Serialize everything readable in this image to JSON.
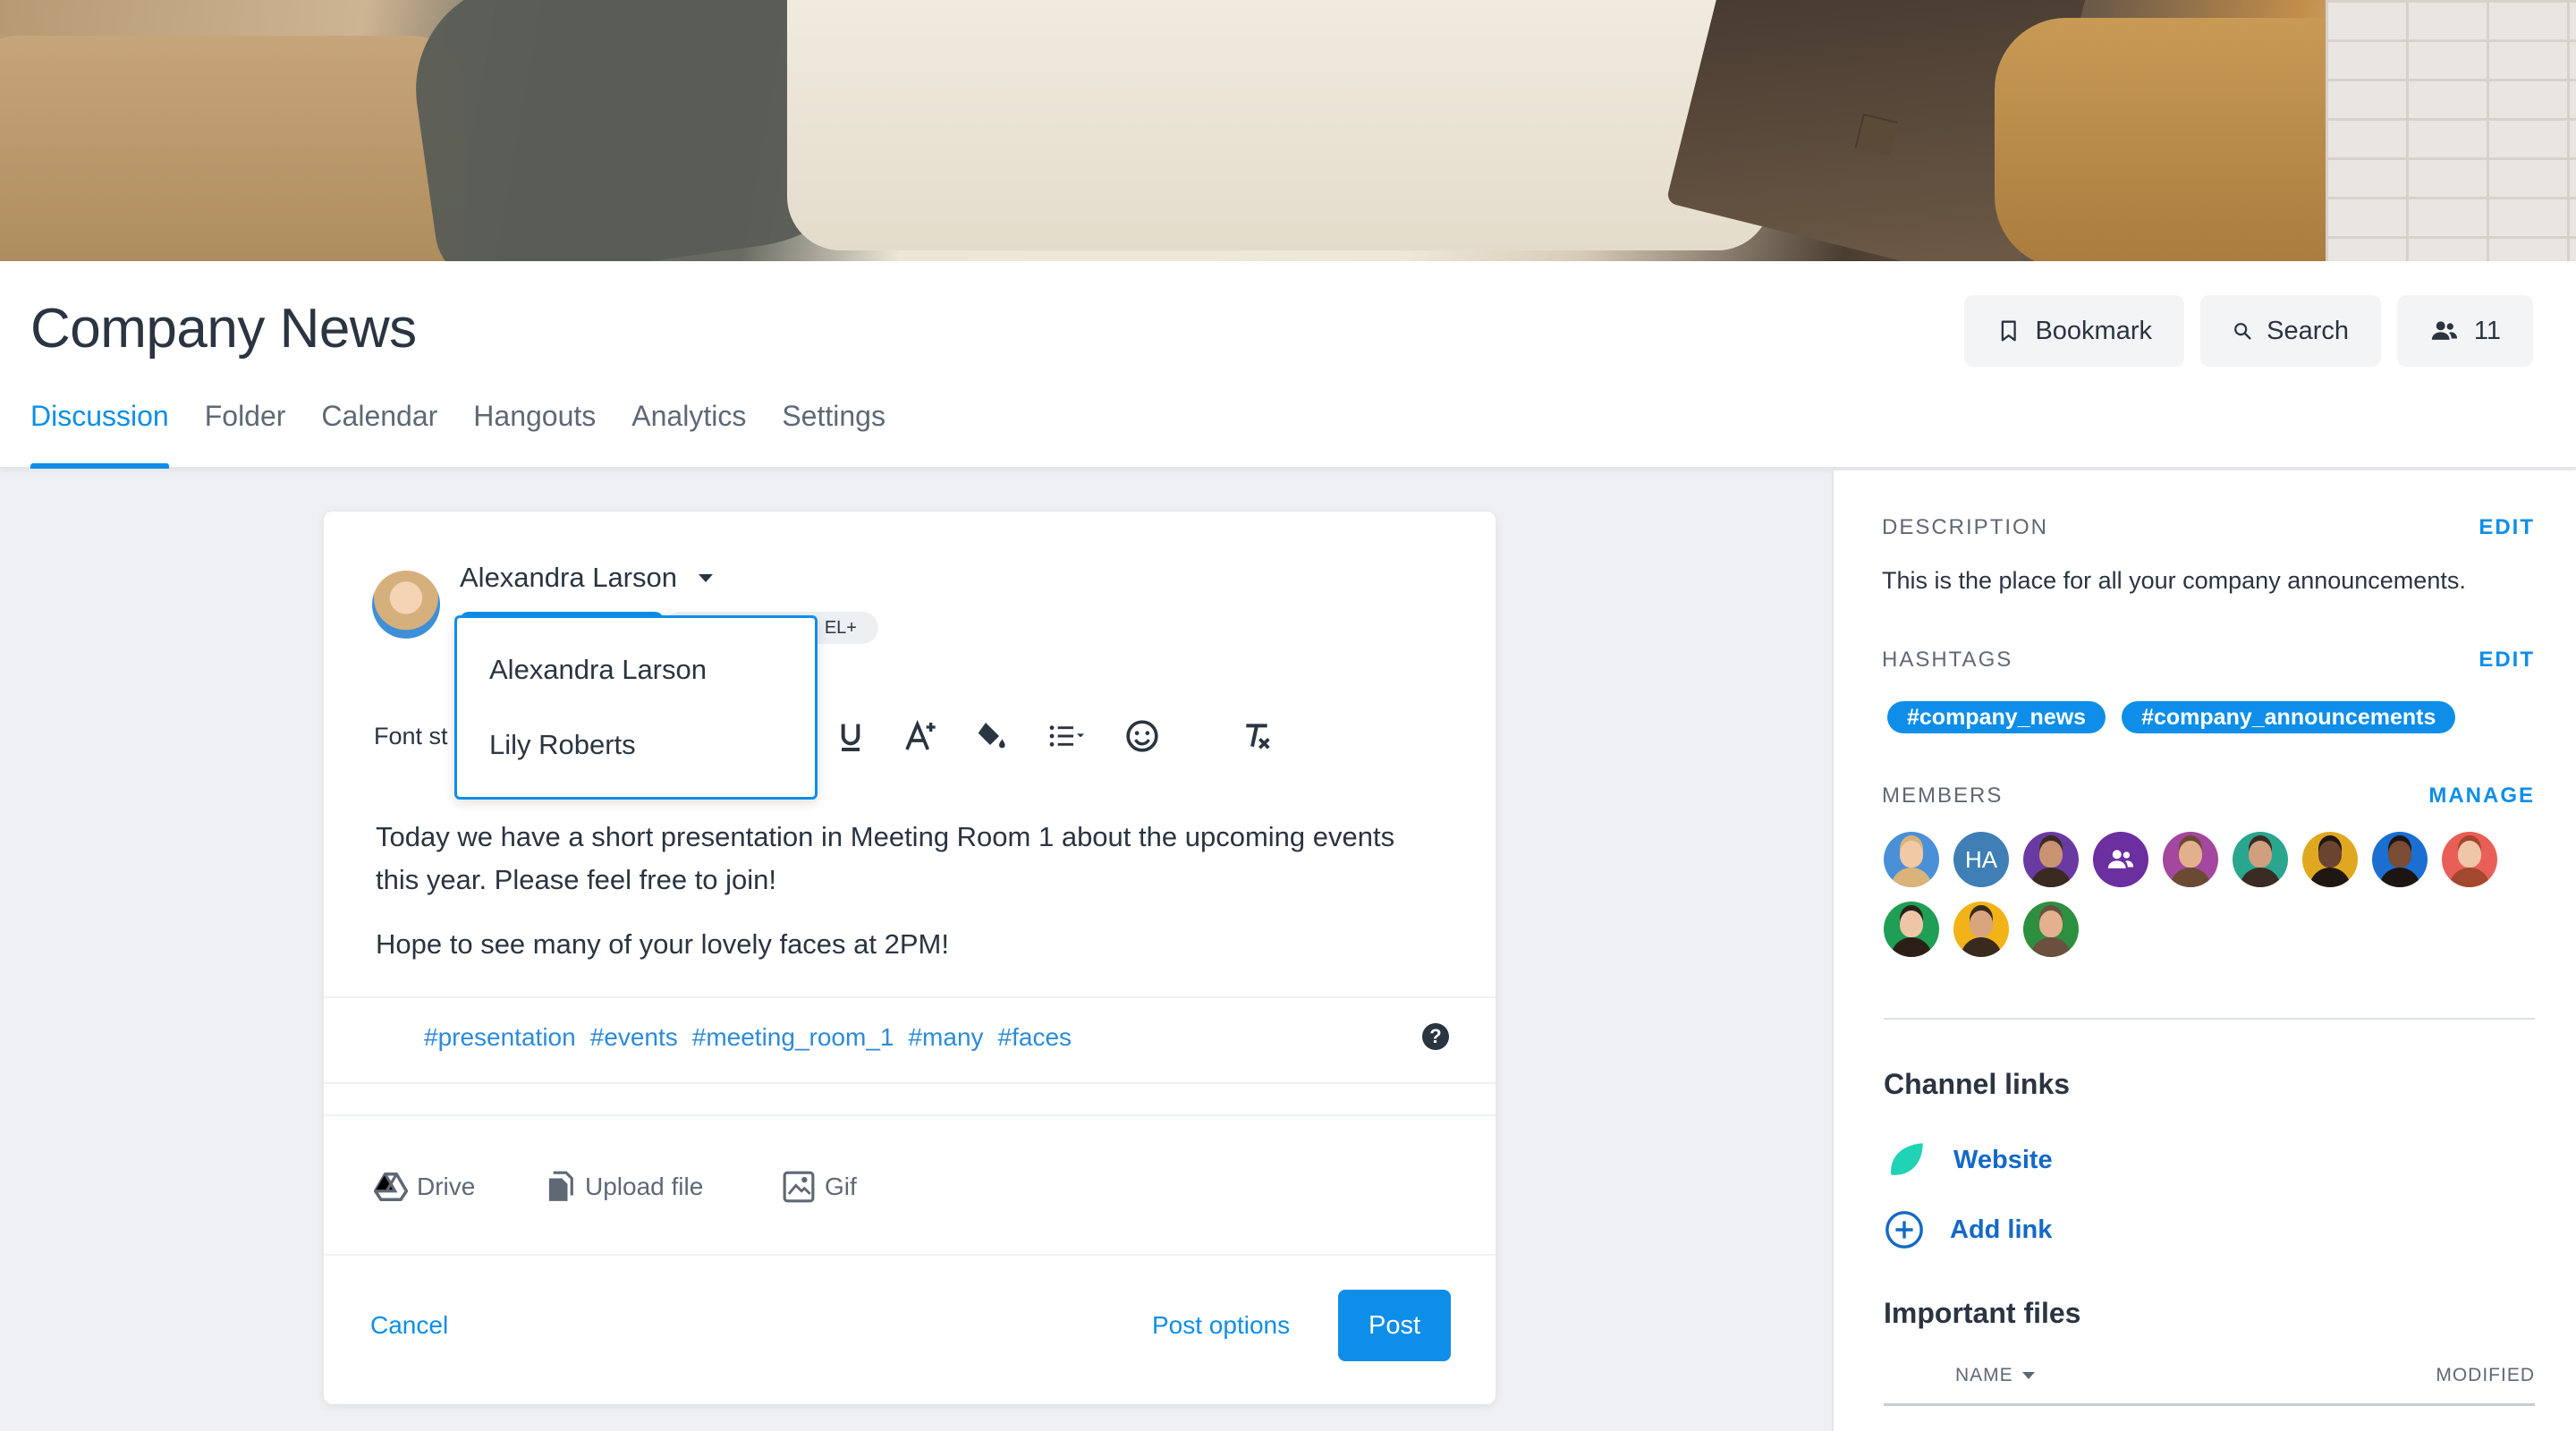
{
  "channel": {
    "title": "Company News",
    "actions": {
      "bookmark": "Bookmark",
      "search": "Search",
      "members_count": "11"
    },
    "tabs": [
      "Discussion",
      "Folder",
      "Calendar",
      "Hangouts",
      "Analytics",
      "Settings"
    ],
    "active_tab": "Discussion"
  },
  "composer": {
    "author": "Alexandra Larson",
    "audience_pill_text": "EL+",
    "font_style_label": "Font st",
    "author_options": [
      "Alexandra Larson",
      "Lily Roberts"
    ],
    "message": [
      "Today we have a short presentation in Meeting Room 1 about the upcoming events this year. Please feel free to join!",
      "Hope to see many of your lovely faces at 2PM!"
    ],
    "hashtags": [
      "#presentation",
      "#events",
      "#meeting_room_1",
      "#many",
      "#faces"
    ],
    "help_glyph": "?",
    "attachments": {
      "drive": "Drive",
      "upload": "Upload file",
      "gif": "Gif"
    },
    "cancel": "Cancel",
    "post_options": "Post options",
    "post": "Post"
  },
  "sidebar": {
    "description": {
      "heading": "DESCRIPTION",
      "action": "EDIT",
      "text": "This is the place for all your company announcements."
    },
    "hashtags": {
      "heading": "HASHTAGS",
      "action": "EDIT",
      "items": [
        "#company_news",
        "#company_announcements"
      ]
    },
    "members": {
      "heading": "MEMBERS",
      "action": "MANAGE",
      "items": [
        {
          "initials": "",
          "bg": "#4a90d9",
          "skin": "#f1c9a5",
          "hair": "#d9b37a"
        },
        {
          "initials": "HA",
          "bg": "#3f7fb6",
          "skin": "",
          "hair": ""
        },
        {
          "initials": "",
          "bg": "#6a3aa3",
          "skin": "#c99271",
          "hair": "#3a2a22"
        },
        {
          "initials": "",
          "bg": "#6b2fa0",
          "skin": "",
          "hair": "",
          "icon": "group"
        },
        {
          "initials": "",
          "bg": "#a3479f",
          "skin": "#e3b08d",
          "hair": "#6b4a34"
        },
        {
          "initials": "",
          "bg": "#2aa68e",
          "skin": "#cf9f7f",
          "hair": "#3a2c22"
        },
        {
          "initials": "",
          "bg": "#e0a820",
          "skin": "#6b4331",
          "hair": "#1f1712"
        },
        {
          "initials": "",
          "bg": "#1a6fd0",
          "skin": "#7a4b35",
          "hair": "#1d1512"
        },
        {
          "initials": "",
          "bg": "#e95f57",
          "skin": "#f0c6a9",
          "hair": "#a4472f"
        },
        {
          "initials": "",
          "bg": "#1f9e55",
          "skin": "#eec5a6",
          "hair": "#2b1f18"
        },
        {
          "initials": "",
          "bg": "#f1b318",
          "skin": "#d9a57f",
          "hair": "#3a2a1e"
        },
        {
          "initials": "",
          "bg": "#2d8f3f",
          "skin": "#e5b08e",
          "hair": "#6b5040"
        }
      ]
    },
    "channel_links": {
      "title": "Channel links",
      "website": "Website",
      "add_link": "Add link"
    },
    "important_files": {
      "title": "Important files",
      "col_name": "NAME",
      "col_modified": "MODIFIED"
    }
  },
  "colors": {
    "accent": "#0e8ee8",
    "link_dark": "#1469c7",
    "text": "#2b3441",
    "muted": "#5f6875"
  }
}
